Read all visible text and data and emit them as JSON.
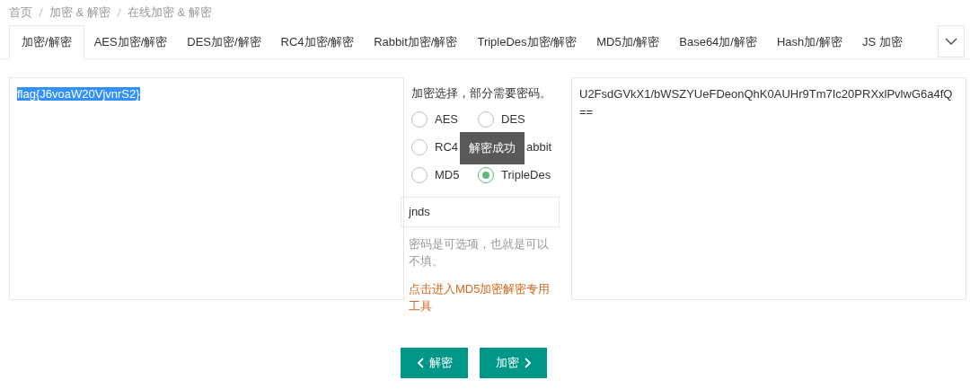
{
  "breadcrumb": [
    "首页",
    "加密 & 解密",
    "在线加密 & 解密"
  ],
  "tabs": [
    {
      "label": "加密/解密",
      "selected": true
    },
    {
      "label": "AES加密/解密",
      "selected": false
    },
    {
      "label": "DES加密/解密",
      "selected": false
    },
    {
      "label": "RC4加密/解密",
      "selected": false
    },
    {
      "label": "Rabbit加密/解密",
      "selected": false
    },
    {
      "label": "TripleDes加密/解密",
      "selected": false
    },
    {
      "label": "MD5加/解密",
      "selected": false
    },
    {
      "label": "Base64加/解密",
      "selected": false
    },
    {
      "label": "Hash加/解密",
      "selected": false
    },
    {
      "label": "JS 加密",
      "selected": false
    }
  ],
  "plaintext": {
    "value": "flag{J6voaW20VjvnrS2}",
    "highlighted": true
  },
  "options": {
    "heading": "加密选择，部分需要密码。",
    "algorithms": [
      {
        "label": "AES",
        "selected": false
      },
      {
        "label": "DES",
        "selected": false
      },
      {
        "label": "RC4",
        "selected": false
      },
      {
        "label": "abbit"
      },
      {
        "label": "MD5",
        "selected": false
      },
      {
        "label": "TripleDes",
        "selected": true
      }
    ],
    "password": "jnds",
    "hint": "密码是可选项，也就是可以不填。",
    "md5_link": "点击进入MD5加密解密专用工具"
  },
  "ciphertext": "U2FsdGVkX1/bWSZYUeFDeonQhK0AUHr9Tm7Ic20PRXxlPvlwG6a4fQ==",
  "toast": "解密成功",
  "buttons": [
    {
      "kind": "decrypt",
      "label": "解密"
    },
    {
      "kind": "encrypt",
      "label": "加密"
    }
  ]
}
